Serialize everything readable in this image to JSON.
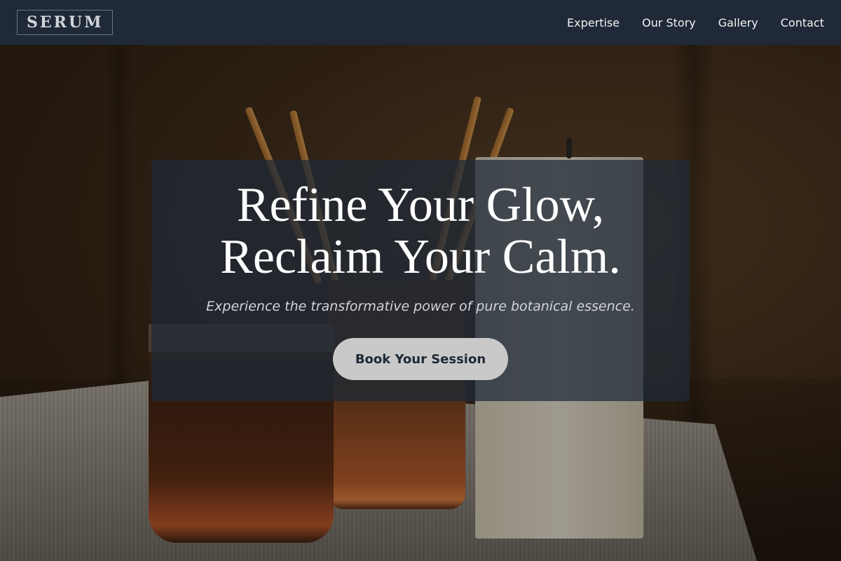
{
  "nav": {
    "logo": "SERUM",
    "links": [
      {
        "label": "Expertise"
      },
      {
        "label": "Our Story"
      },
      {
        "label": "Gallery"
      },
      {
        "label": "Contact"
      }
    ]
  },
  "hero": {
    "headline_line1": "Refine Your Glow,",
    "headline_line2": "Reclaim Your Calm.",
    "subtitle": "Experience the transformative power of pure botanical essence.",
    "cta_label": "Book Your Session",
    "background_image": "candles-and-reed-diffusers"
  },
  "colors": {
    "nav_bg": "#1f2937",
    "overlay": "#1f2937",
    "cta_bg": "#c9c9c9",
    "cta_text": "#1f2937"
  }
}
